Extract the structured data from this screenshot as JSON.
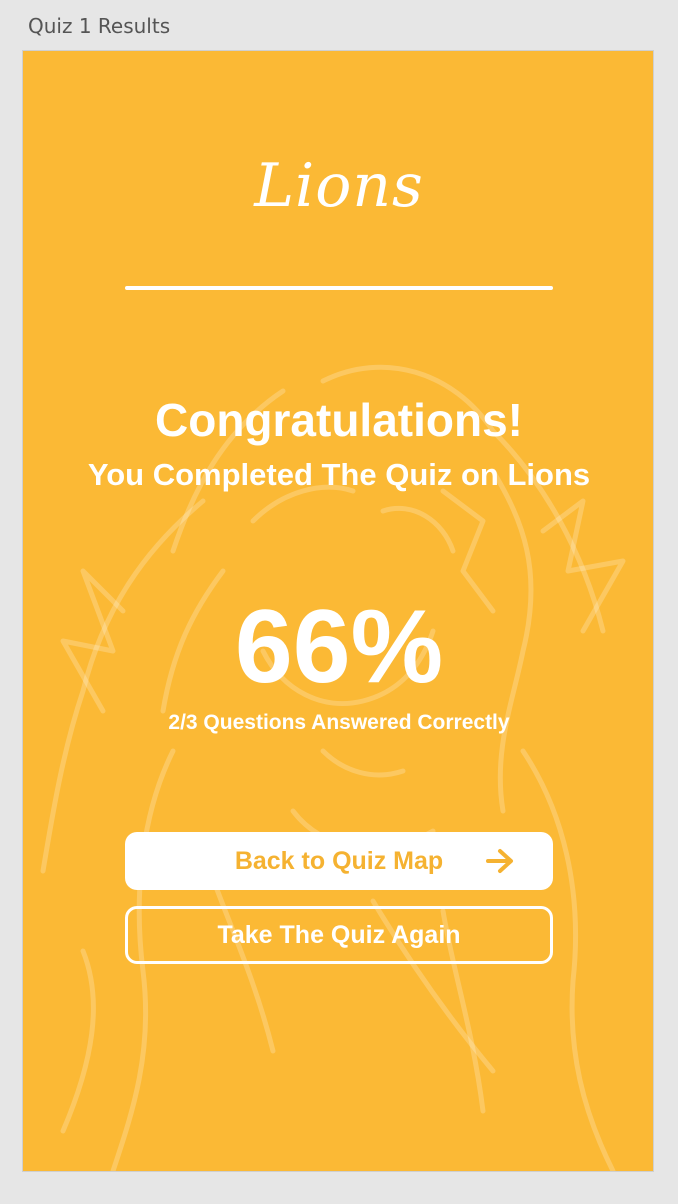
{
  "artboard": {
    "label": "Quiz 1 Results"
  },
  "header": {
    "title": "Lions"
  },
  "results": {
    "headline": "Congratulations!",
    "subtitle": "You Completed The Quiz on Lions",
    "score": "66%",
    "score_detail": "2/3 Questions Answered Correctly"
  },
  "actions": {
    "back_label": "Back to Quiz Map",
    "back_icon": "arrow-right-icon",
    "retake_label": "Take The Quiz Again"
  },
  "colors": {
    "background": "#fbb935",
    "accent": "#f5b231",
    "text": "#ffffff"
  }
}
